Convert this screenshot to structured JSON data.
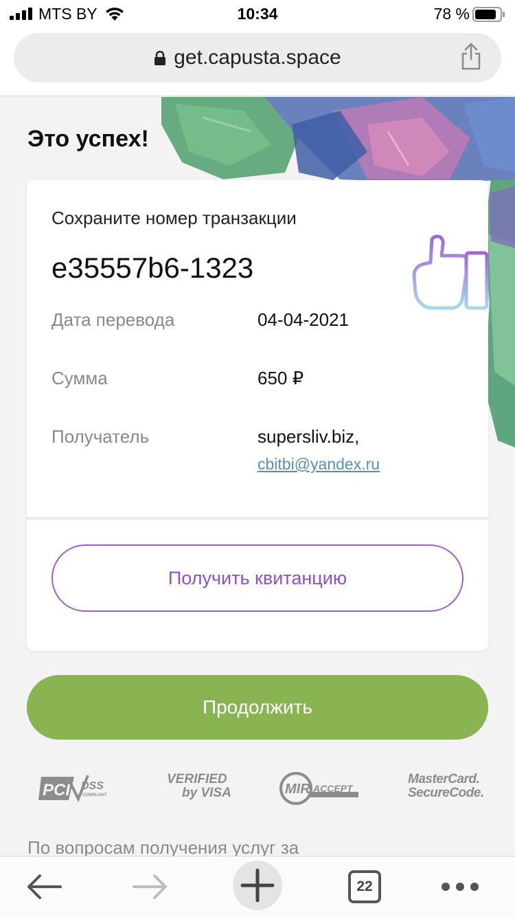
{
  "status_bar": {
    "carrier": "MTS BY",
    "time": "10:34",
    "battery": "78 %"
  },
  "browser": {
    "url": "get.capusta.space"
  },
  "page": {
    "title": "Это успех!",
    "card": {
      "save_label": "Сохраните номер транзакции",
      "transaction_id": "e35557b6-1323",
      "rows": [
        {
          "label": "Дата перевода",
          "value": "04-04-2021"
        },
        {
          "label": "Сумма",
          "value": "650 ₽"
        },
        {
          "label": "Получатель",
          "value": "supersliv.biz,",
          "link": "cbitbi@yandex.ru"
        }
      ],
      "receipt_button": "Получить квитанцию"
    },
    "continue_button": "Продолжить",
    "logos": {
      "pci": "PCI DSS",
      "pci_sub": "COMPLIANT",
      "visa_line1": "VERIFIED",
      "visa_line2": "by VISA",
      "mir": "MIR",
      "mir_accept": "ACCEPT",
      "mc_line1": "MasterCard.",
      "mc_line2": "SecureCode."
    },
    "footer_text": "По вопросам получения услуг за"
  },
  "toolbar": {
    "tabs_count": "22"
  },
  "colors": {
    "accent_green": "#8ab352",
    "accent_purple": "#9a5fd1",
    "link_blue": "#5a8fb1"
  }
}
